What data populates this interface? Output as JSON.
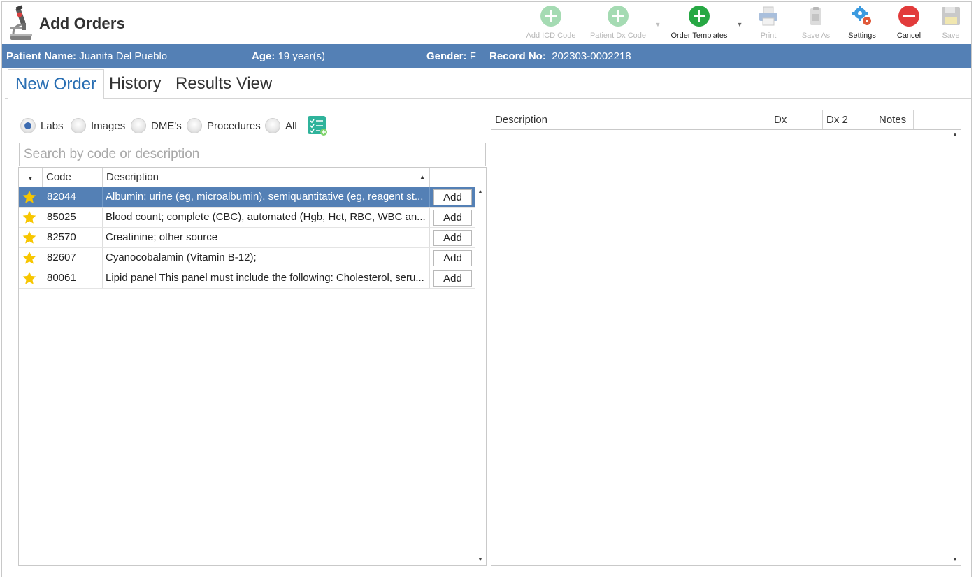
{
  "app": {
    "title": "Add Orders"
  },
  "toolbar": {
    "add_icd_code": "Add ICD Code",
    "patient_dx_code": "Patient Dx Code",
    "order_templates": "Order Templates",
    "print": "Print",
    "save_as": "Save As",
    "settings": "Settings",
    "cancel": "Cancel",
    "save": "Save"
  },
  "patient": {
    "name_label": "Patient Name:",
    "name": "Juanita Del Pueblo",
    "age_label": "Age:",
    "age": "19 year(s)",
    "gender_label": "Gender:",
    "gender": "F",
    "record_label": "Record No:",
    "record": "202303-0002218"
  },
  "tabs": [
    {
      "label": "New Order",
      "active": true
    },
    {
      "label": "History",
      "active": false
    },
    {
      "label": "Results View",
      "active": false
    }
  ],
  "filters": [
    {
      "label": "Labs",
      "checked": true
    },
    {
      "label": "Images",
      "checked": false
    },
    {
      "label": "DME's",
      "checked": false
    },
    {
      "label": "Procedures",
      "checked": false
    },
    {
      "label": "All",
      "checked": false
    }
  ],
  "search": {
    "placeholder": "Search by code or description",
    "value": ""
  },
  "left_grid": {
    "columns": [
      "",
      "Code",
      "Description",
      ""
    ],
    "rows": [
      {
        "favorite": true,
        "code": "82044",
        "description": "Albumin; urine (eg, microalbumin), semiquantitative (eg, reagent st...",
        "action": "Add",
        "selected": true
      },
      {
        "favorite": true,
        "code": "85025",
        "description": "Blood count; complete (CBC), automated (Hgb, Hct, RBC, WBC an...",
        "action": "Add",
        "selected": false
      },
      {
        "favorite": true,
        "code": "82570",
        "description": "Creatinine; other source",
        "action": "Add",
        "selected": false
      },
      {
        "favorite": true,
        "code": "82607",
        "description": "Cyanocobalamin (Vitamin B-12);",
        "action": "Add",
        "selected": false
      },
      {
        "favorite": true,
        "code": "80061",
        "description": "Lipid panel This panel must include the following: Cholesterol, seru...",
        "action": "Add",
        "selected": false
      }
    ]
  },
  "right_grid": {
    "columns": [
      "Description",
      "Dx",
      "Dx 2",
      "Notes",
      ""
    ]
  },
  "colors": {
    "accent": "#5480b5",
    "tab_active": "#2a6fb3",
    "star": "#f7c600",
    "add_green": "#27a844",
    "cancel_red": "#e23b3b"
  }
}
